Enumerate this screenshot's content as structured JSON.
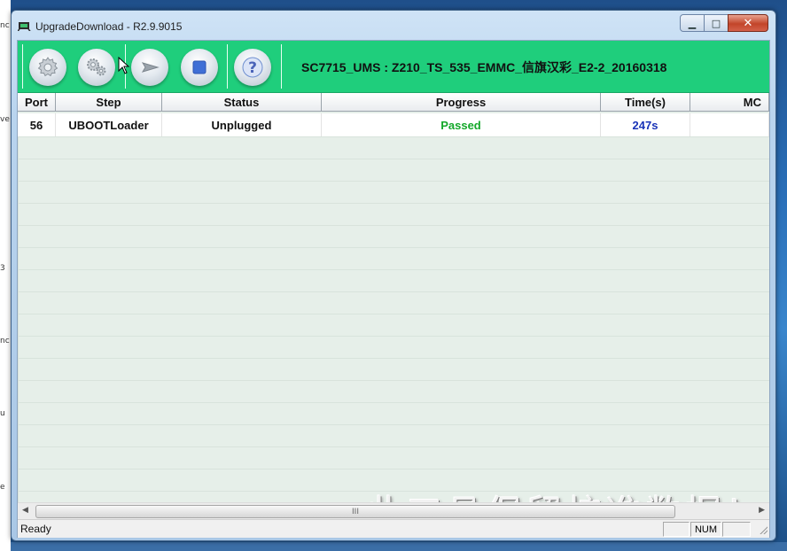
{
  "window": {
    "title": "UpgradeDownload - R2.9.9015",
    "minimize_symbol": "▁",
    "maximize_symbol": "□",
    "close_symbol": "✕"
  },
  "toolbar": {
    "buttons": [
      {
        "name": "settings-button",
        "icon": "gear-icon"
      },
      {
        "name": "advanced-settings-button",
        "icon": "gears-icon"
      },
      {
        "name": "start-button",
        "icon": "play-arrow-icon"
      },
      {
        "name": "stop-button",
        "icon": "stop-icon"
      },
      {
        "name": "help-button",
        "icon": "help-icon",
        "glyph": "?"
      }
    ],
    "firmware_label": "SC7715_UMS : Z210_TS_535_EMMC_信旗汉彩_E2-2_20160318",
    "accent_color": "#1fce7c"
  },
  "table": {
    "columns": [
      "Port",
      "Step",
      "Status",
      "Progress",
      "Time(s)",
      "MC"
    ],
    "rows": [
      {
        "port": "56",
        "step": "UBOOTLoader",
        "status": "Unplugged",
        "progress": "Passed",
        "time": "247s",
        "mc": ""
      }
    ]
  },
  "watermark": "此工具保留校准数据！",
  "scrollbar": {
    "thumb_grip": "III",
    "left_arrow": "◀",
    "right_arrow": "▶"
  },
  "statusbar": {
    "text": "Ready",
    "num_indicator": "NUM"
  },
  "colors": {
    "passed": "#14a82a",
    "time": "#1a34b8"
  }
}
